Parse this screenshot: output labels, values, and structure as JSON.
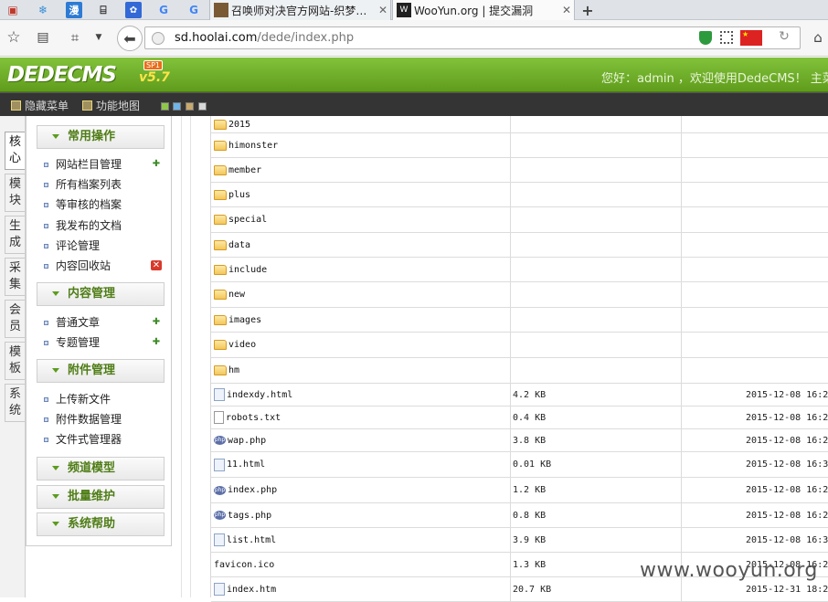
{
  "browser": {
    "tabs": [
      {
        "title": "召唤师对决官方网站-织梦…",
        "icon": "game-avatar-icon"
      },
      {
        "title": "WooYun.org | 提交漏洞",
        "icon": "wooyun-icon"
      }
    ],
    "pinned_icons": [
      "snowflake-icon",
      "kuaibo-icon",
      "robot-icon",
      "baidu-paw-icon",
      "google-g-icon",
      "google-g-icon"
    ],
    "url_host": "sd.hoolai.com",
    "url_path": "/dede/index.php",
    "new_tab_label": "+"
  },
  "cms": {
    "logo_text": "DEDECMS",
    "version": "v5.7",
    "sp": "SP1",
    "welcome": "您好：admin ，欢迎使用DedeCMS！  主菜",
    "toolbar": {
      "hide_menu": "隐藏菜单",
      "site_map": "功能地图"
    }
  },
  "sidetabs": [
    "核心",
    "模块",
    "生成",
    "采集",
    "会员",
    "模板",
    "系统"
  ],
  "menu": {
    "sections": [
      {
        "title": "常用操作",
        "items": [
          "网站栏目管理",
          "所有档案列表",
          "等审核的档案",
          "我发布的文档",
          "评论管理",
          "内容回收站"
        ]
      },
      {
        "title": "内容管理",
        "items": [
          "普通文章",
          "专题管理"
        ]
      },
      {
        "title": "附件管理",
        "items": [
          "上传新文件",
          "附件数据管理",
          "文件式管理器"
        ]
      },
      {
        "title": "频道模型",
        "items": []
      },
      {
        "title": "批量维护",
        "items": []
      },
      {
        "title": "系统帮助",
        "items": []
      }
    ]
  },
  "files": [
    {
      "name": "2015",
      "type": "folder",
      "size": "",
      "date": ""
    },
    {
      "name": "himonster",
      "type": "folder",
      "size": "",
      "date": ""
    },
    {
      "name": "member",
      "type": "folder",
      "size": "",
      "date": ""
    },
    {
      "name": "plus",
      "type": "folder",
      "size": "",
      "date": ""
    },
    {
      "name": "special",
      "type": "folder",
      "size": "",
      "date": ""
    },
    {
      "name": "data",
      "type": "folder",
      "size": "",
      "date": ""
    },
    {
      "name": "include",
      "type": "folder",
      "size": "",
      "date": ""
    },
    {
      "name": "new",
      "type": "folder",
      "size": "",
      "date": ""
    },
    {
      "name": "images",
      "type": "folder",
      "size": "",
      "date": ""
    },
    {
      "name": "video",
      "type": "folder",
      "size": "",
      "date": ""
    },
    {
      "name": "hm",
      "type": "folder",
      "size": "",
      "date": ""
    },
    {
      "name": "indexdy.html",
      "type": "html",
      "size": "4.2 KB",
      "date": "2015-12-08 16:2"
    },
    {
      "name": "robots.txt",
      "type": "txt",
      "size": "0.4 KB",
      "date": "2015-12-08 16:2"
    },
    {
      "name": "wap.php",
      "type": "php",
      "size": "3.8 KB",
      "date": "2015-12-08 16:2"
    },
    {
      "name": "11.html",
      "type": "html",
      "size": "0.01 KB",
      "date": "2015-12-08 16:3"
    },
    {
      "name": "index.php",
      "type": "php",
      "size": "1.2 KB",
      "date": "2015-12-08 16:2"
    },
    {
      "name": "tags.php",
      "type": "php",
      "size": "0.8 KB",
      "date": "2015-12-08 16:2"
    },
    {
      "name": "list.html",
      "type": "html",
      "size": "3.9 KB",
      "date": "2015-12-08 16:3"
    },
    {
      "name": "favicon.ico",
      "type": "ico",
      "size": "1.3 KB",
      "date": "2015-12-08 16:2"
    },
    {
      "name": "index.htm",
      "type": "html",
      "size": "20.7 KB",
      "date": "2015-12-31 18:2"
    }
  ],
  "watermark": "www.wooyun.org"
}
